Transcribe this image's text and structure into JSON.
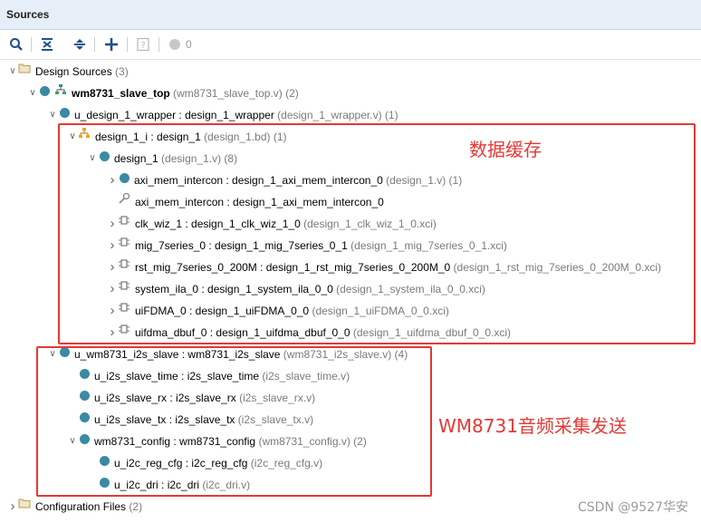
{
  "panel": {
    "title": "Sources"
  },
  "toolbar": {
    "badge_count": "0"
  },
  "tree": [
    {
      "id": "r0",
      "indent": 0,
      "expand": "down",
      "icon": "folder",
      "name": "Design Sources",
      "suffix": " (3)",
      "bold": false
    },
    {
      "id": "r1",
      "indent": 1,
      "expand": "down",
      "icon": "top",
      "name": "wm8731_slave_top",
      "suffix": " (wm8731_slave_top.v) (2)",
      "bold": true
    },
    {
      "id": "r2",
      "indent": 2,
      "expand": "down",
      "icon": "dot",
      "name": "u_design_1_wrapper : design_1_wrapper",
      "suffix": " (design_1_wrapper.v) (1)",
      "bold": false
    },
    {
      "id": "r3",
      "indent": 3,
      "expand": "down",
      "icon": "bd",
      "name": "design_1_i : design_1",
      "suffix": " (design_1.bd) (1)",
      "bold": false
    },
    {
      "id": "r4",
      "indent": 4,
      "expand": "down",
      "icon": "dot",
      "name": "design_1",
      "suffix": " (design_1.v) (8)",
      "bold": false
    },
    {
      "id": "r5",
      "indent": 5,
      "expand": "right",
      "icon": "dot",
      "name": "axi_mem_intercon : design_1_axi_mem_intercon_0",
      "suffix": " (design_1.v) (1)",
      "bold": false
    },
    {
      "id": "r6",
      "indent": 5,
      "expand": "none",
      "icon": "wrench",
      "name": "axi_mem_intercon : design_1_axi_mem_intercon_0",
      "suffix": "",
      "bold": false
    },
    {
      "id": "r7",
      "indent": 5,
      "expand": "right",
      "icon": "ip",
      "name": "clk_wiz_1 : design_1_clk_wiz_1_0",
      "suffix": " (design_1_clk_wiz_1_0.xci)",
      "bold": false
    },
    {
      "id": "r8",
      "indent": 5,
      "expand": "right",
      "icon": "ip",
      "name": "mig_7series_0 : design_1_mig_7series_0_1",
      "suffix": " (design_1_mig_7series_0_1.xci)",
      "bold": false
    },
    {
      "id": "r9",
      "indent": 5,
      "expand": "right",
      "icon": "ip",
      "name": "rst_mig_7series_0_200M : design_1_rst_mig_7series_0_200M_0",
      "suffix": " (design_1_rst_mig_7series_0_200M_0.xci)",
      "bold": false
    },
    {
      "id": "r10",
      "indent": 5,
      "expand": "right",
      "icon": "ip",
      "name": "system_ila_0 : design_1_system_ila_0_0",
      "suffix": " (design_1_system_ila_0_0.xci)",
      "bold": false
    },
    {
      "id": "r11",
      "indent": 5,
      "expand": "right",
      "icon": "ip",
      "name": "uiFDMA_0 : design_1_uiFDMA_0_0",
      "suffix": " (design_1_uiFDMA_0_0.xci)",
      "bold": false
    },
    {
      "id": "r12",
      "indent": 5,
      "expand": "right",
      "icon": "ip",
      "name": "uifdma_dbuf_0 : design_1_uifdma_dbuf_0_0",
      "suffix": " (design_1_uifdma_dbuf_0_0.xci)",
      "bold": false
    },
    {
      "id": "r13",
      "indent": 2,
      "expand": "down",
      "icon": "dot",
      "name": "u_wm8731_i2s_slave : wm8731_i2s_slave",
      "suffix": " (wm8731_i2s_slave.v) (4)",
      "bold": false
    },
    {
      "id": "r14",
      "indent": 3,
      "expand": "none",
      "icon": "dot",
      "name": "u_i2s_slave_time : i2s_slave_time",
      "suffix": " (i2s_slave_time.v)",
      "bold": false
    },
    {
      "id": "r15",
      "indent": 3,
      "expand": "none",
      "icon": "dot",
      "name": "u_i2s_slave_rx : i2s_slave_rx",
      "suffix": " (i2s_slave_rx.v)",
      "bold": false
    },
    {
      "id": "r16",
      "indent": 3,
      "expand": "none",
      "icon": "dot",
      "name": "u_i2s_slave_tx : i2s_slave_tx",
      "suffix": " (i2s_slave_tx.v)",
      "bold": false
    },
    {
      "id": "r17",
      "indent": 3,
      "expand": "down",
      "icon": "dot",
      "name": "wm8731_config : wm8731_config",
      "suffix": " (wm8731_config.v) (2)",
      "bold": false
    },
    {
      "id": "r18",
      "indent": 4,
      "expand": "none",
      "icon": "dot",
      "name": "u_i2c_reg_cfg : i2c_reg_cfg",
      "suffix": " (i2c_reg_cfg.v)",
      "bold": false
    },
    {
      "id": "r19",
      "indent": 4,
      "expand": "none",
      "icon": "dot",
      "name": "u_i2c_dri : i2c_dri",
      "suffix": " (i2c_dri.v)",
      "bold": false
    },
    {
      "id": "r20",
      "indent": 0,
      "expand": "right",
      "icon": "folder",
      "name": "Configuration Files",
      "suffix": " (2)",
      "bold": false
    }
  ],
  "annotations": {
    "cache_label": "数据缓存",
    "audio_label": "WM8731音频采集发送"
  },
  "watermark": "CSDN @9527华安",
  "colors": {
    "module_dot": "#3a8aa4",
    "annotation_red": "#e53935",
    "header_bg": "#e6eef8"
  }
}
